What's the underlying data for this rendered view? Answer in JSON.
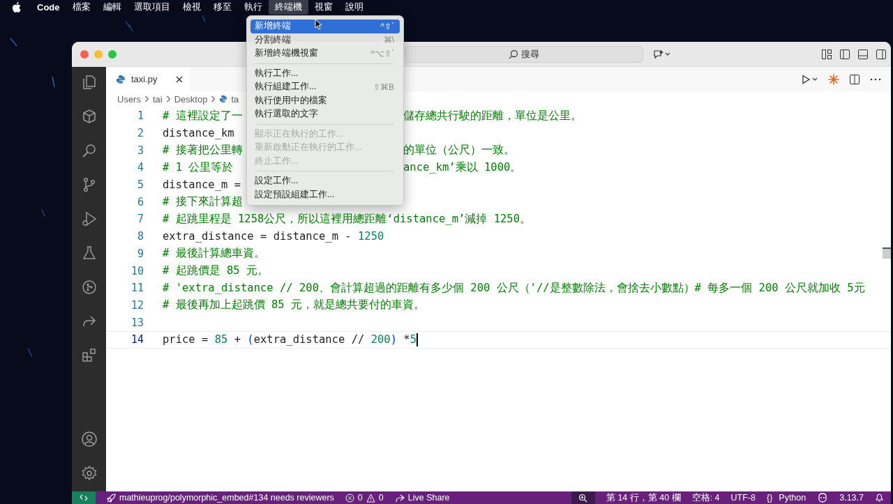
{
  "menubar": {
    "items": [
      {
        "label": "Code",
        "selected": false
      },
      {
        "label": "檔案",
        "selected": false
      },
      {
        "label": "編輯",
        "selected": false
      },
      {
        "label": "選取項目",
        "selected": false
      },
      {
        "label": "檢視",
        "selected": false
      },
      {
        "label": "移至",
        "selected": false
      },
      {
        "label": "執行",
        "selected": false
      },
      {
        "label": "終端機",
        "selected": true
      },
      {
        "label": "視窗",
        "selected": false
      },
      {
        "label": "說明",
        "selected": false
      }
    ]
  },
  "terminal_menu": {
    "items": [
      {
        "kind": "item",
        "label": "新增終端",
        "shortcut": "^⇧`",
        "selected": true,
        "disabled": false
      },
      {
        "kind": "item",
        "label": "分割終端",
        "shortcut": "⌘\\",
        "selected": false,
        "disabled": false
      },
      {
        "kind": "item",
        "label": "新增終端機視窗",
        "shortcut": "^⌥⇧`",
        "selected": false,
        "disabled": false
      },
      {
        "kind": "separator"
      },
      {
        "kind": "item",
        "label": "執行工作...",
        "selected": false,
        "disabled": false
      },
      {
        "kind": "item",
        "label": "執行組建工作...",
        "shortcut": "⇧⌘B",
        "selected": false,
        "disabled": false
      },
      {
        "kind": "item",
        "label": "執行使用中的檔案",
        "selected": false,
        "disabled": false
      },
      {
        "kind": "item",
        "label": "執行選取的文字",
        "selected": false,
        "disabled": false
      },
      {
        "kind": "separator"
      },
      {
        "kind": "item",
        "label": "顯示正在執行的工作...",
        "selected": false,
        "disabled": true
      },
      {
        "kind": "item",
        "label": "重新啟動正在執行的工作...",
        "selected": false,
        "disabled": true
      },
      {
        "kind": "item",
        "label": "終止工作...",
        "selected": false,
        "disabled": true
      },
      {
        "kind": "separator"
      },
      {
        "kind": "item",
        "label": "設定工作...",
        "selected": false,
        "disabled": false
      },
      {
        "kind": "item",
        "label": "設定預設組建工作...",
        "selected": false,
        "disabled": false
      }
    ]
  },
  "window": {
    "search": {
      "placeholder": "搜尋"
    },
    "tabs": [
      {
        "label": "taxi.py",
        "selected": true
      }
    ],
    "breadcrumb": [
      "Users",
      "tai",
      "Desktop",
      "ta"
    ],
    "editor": {
      "lines": [
        {
          "number": "1",
          "current": false,
          "left": [
            {
              "kind": "comment",
              "text": "# 這裡設定了一"
            }
          ],
          "right": [
            {
              "kind": "comment",
              "text": "儲存總共行駛的距離，單位是公里。"
            }
          ]
        },
        {
          "number": "2",
          "current": false,
          "left": [
            {
              "kind": "plain",
              "text": "distance_km"
            }
          ]
        },
        {
          "number": "3",
          "current": false,
          "left": [
            {
              "kind": "comment",
              "text": "# 接著把公里轉"
            }
          ],
          "right": [
            {
              "kind": "comment",
              "text": "的單位（公尺）一致。"
            }
          ]
        },
        {
          "number": "4",
          "current": false,
          "left": [
            {
              "kind": "comment",
              "text": "# 1 公里等於"
            }
          ],
          "right": [
            {
              "kind": "comment",
              "text": "ance_km’乘以 1000。"
            }
          ]
        },
        {
          "number": "5",
          "current": false,
          "left": [
            {
              "kind": "plain",
              "text": "distance_m ="
            }
          ]
        },
        {
          "number": "6",
          "current": false,
          "left": [
            {
              "kind": "comment",
              "text": "# 接下來計算超"
            }
          ]
        },
        {
          "number": "7",
          "current": false,
          "left": [
            {
              "kind": "comment",
              "text": "# 起跳里程是 1258公尺，所以這裡用總距離‘distance_m’減掉 1250。"
            }
          ]
        },
        {
          "number": "8",
          "current": false,
          "left": [
            {
              "kind": "plain",
              "text": "extra_distance = distance_m - "
            },
            {
              "kind": "number",
              "text": "1250"
            }
          ]
        },
        {
          "number": "9",
          "current": false,
          "left": [
            {
              "kind": "comment",
              "text": "# 最後計算總車資。"
            }
          ]
        },
        {
          "number": "10",
          "current": false,
          "left": [
            {
              "kind": "comment",
              "text": "# 起跳價是 85 元。"
            }
          ]
        },
        {
          "number": "11",
          "current": false,
          "left": [
            {
              "kind": "comment",
              "text": "# 'extra_distance // 200、會計算超過的距離有多少個 200 公尺（'//是整數除法，會捨去小數點）# 每多一個 200 公尺就加收 5元"
            }
          ]
        },
        {
          "number": "12",
          "current": false,
          "left": [
            {
              "kind": "comment",
              "text": "# 最後再加上起跳價 85 元，就是總共要付的車資。"
            }
          ]
        },
        {
          "number": "13",
          "current": false
        },
        {
          "number": "14",
          "current": true,
          "left": [
            {
              "kind": "plain",
              "text": "price = "
            },
            {
              "kind": "number",
              "text": "85"
            },
            {
              "kind": "plain",
              "text": " + "
            },
            {
              "kind": "paren",
              "text": "("
            },
            {
              "kind": "plain",
              "text": "extra_distance // "
            },
            {
              "kind": "number",
              "text": "200"
            },
            {
              "kind": "paren",
              "text": ")"
            },
            {
              "kind": "plain",
              "text": " *"
            },
            {
              "kind": "number",
              "text": "5"
            }
          ]
        }
      ]
    }
  },
  "status_bar": {
    "branch": "mathieuprog/polymorphic_embed#134 needs reviewers",
    "errors": "0",
    "warnings": "0",
    "live_share": "Live Share",
    "position": "第 14 行，第 40 欄",
    "indent": "空格: 4",
    "encoding": "UTF-8",
    "language_braces": "{}",
    "language": "Python",
    "version": "3.13.7"
  }
}
